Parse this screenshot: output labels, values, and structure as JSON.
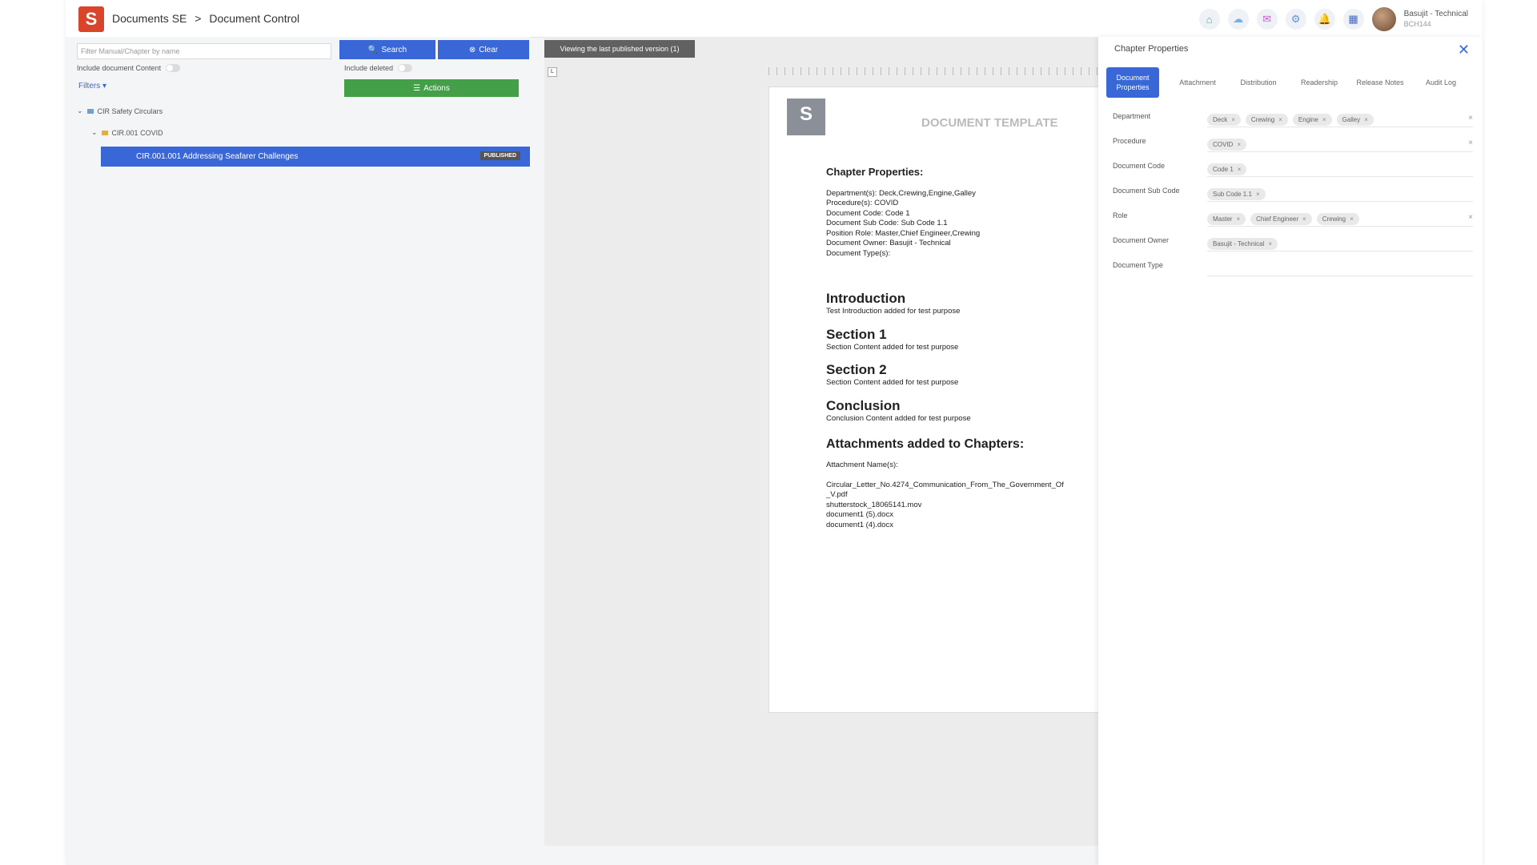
{
  "header": {
    "logo_letter": "S",
    "breadcrumb": [
      "Documents SE",
      ">",
      "Document Control"
    ],
    "icons": [
      "home-icon",
      "cloud-icon",
      "mail-icon",
      "settings-icon",
      "bell-icon",
      "grid-icon"
    ],
    "user_name": "Basujit - Technical",
    "user_id": "BCH144"
  },
  "left": {
    "filter_placeholder": "Filter Manual/Chapter by name",
    "search_label": "Search",
    "clear_label": "Clear",
    "include_content_label": "Include document Content",
    "include_deleted_label": "Include deleted",
    "actions_label": "Actions",
    "filters_label": "Filters",
    "tree": {
      "root": "CIR Safety Circulars",
      "child": "CIR.001 COVID",
      "selected": "CIR.001.001 Addressing Seafarer Challenges",
      "selected_badge": "PUBLISHED"
    }
  },
  "center": {
    "viewing_label": "Viewing the last published version (1)",
    "page": {
      "logo_letter": "S",
      "template_title": "DOCUMENT TEMPLATE",
      "chapter_heading": "Chapter Properties:",
      "props": [
        "Department(s): Deck,Crewing,Engine,Galley",
        "Procedure(s): COVID",
        "Document Code: Code 1",
        "Document Sub Code: Sub Code 1.1",
        "Position Role: Master,Chief Engineer,Crewing",
        "Document Owner: Basujit - Technical",
        "Document Type(s):"
      ],
      "sections": [
        {
          "title": "Introduction",
          "text": "Test Introduction added for test purpose"
        },
        {
          "title": "Section 1",
          "text": "Section Content added for test purpose"
        },
        {
          "title": "Section 2",
          "text": "Section Content added for test purpose"
        },
        {
          "title": "Conclusion",
          "text": "Conclusion Content added for test purpose"
        }
      ],
      "attachments_heading": "Attachments added to Chapters:",
      "attachments_label": "Attachment Name(s):",
      "attachments": [
        "Circular_Letter_No.4274_Communication_From_The_Government_Of",
        "_V.pdf",
        "shutterstock_18065141.mov",
        "document1 (5).docx",
        "document1 (4).docx"
      ]
    }
  },
  "right": {
    "title": "Chapter Properties",
    "tabs": [
      "Document Properties",
      "Attachment",
      "Distribution",
      "Readership",
      "Release Notes",
      "Audit Log"
    ],
    "props": [
      {
        "label": "Department",
        "chips": [
          "Deck",
          "Crewing",
          "Engine",
          "Galley"
        ],
        "clearable": true
      },
      {
        "label": "Procedure",
        "chips": [
          "COVID"
        ],
        "clearable": true
      },
      {
        "label": "Document Code",
        "chips": [
          "Code 1"
        ],
        "clearable": false
      },
      {
        "label": "Document Sub Code",
        "chips": [
          "Sub Code 1.1"
        ],
        "clearable": false
      },
      {
        "label": "Role",
        "chips": [
          "Master",
          "Chief Engineer",
          "Crewing"
        ],
        "clearable": true
      },
      {
        "label": "Document Owner",
        "chips": [
          "Basujit - Technical"
        ],
        "clearable": false
      },
      {
        "label": "Document Type",
        "chips": [],
        "clearable": false
      }
    ],
    "chip_remove": "×",
    "clear_symbol": "×"
  }
}
